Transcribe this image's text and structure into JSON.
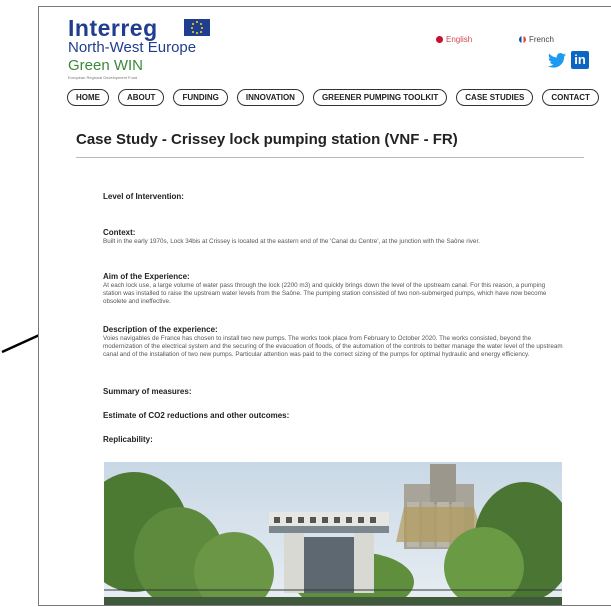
{
  "logo": {
    "interreg": "Interreg",
    "region": "North-West Europe",
    "project": "Green WIN",
    "tagline": "European Regional Development Fund"
  },
  "languages": {
    "english": "English",
    "french": "French"
  },
  "social": {
    "twitter_icon": "twitter-icon",
    "linkedin": "in"
  },
  "nav": [
    "HOME",
    "ABOUT",
    "FUNDING",
    "INNOVATION",
    "GREENER PUMPING TOOLKIT",
    "CASE STUDIES",
    "CONTACT"
  ],
  "page": {
    "title": "Case Study - Crissey lock pumping station  (VNF - FR)"
  },
  "sections": {
    "level": {
      "heading": "Level of Intervention:"
    },
    "context": {
      "heading": "Context:",
      "body": "Built in the early 1970s, Lock 34bis at Crissey is located at the eastern end of the 'Canal du Centre', at the junction with the Saône river."
    },
    "aim": {
      "heading": "Aim of the Experience:",
      "body": "At each lock use, a large volume of water pass through the lock (2200 m3) and quickly brings down the level of the upstream canal. For this reason, a pumping station was installed to raise the upstream water levels from the Saône. The pumping station consisted of two non-submerged pumps, which have now become obsolete and ineffective."
    },
    "description": {
      "heading": "Description of the experience:",
      "body": "Voies navigables de France has chosen to install two new pumps. The works took place from February to October 2020. The works consisted, beyond the modernization of the electrical system and the securing of the evacuation of floods, of the automation of the controls to better manage the water level of the upstream canal and of the installation of two new pumps. Particular attention was paid to the correct sizing of the pumps for optimal hydraulic and energy efficiency."
    },
    "summary": {
      "heading": "Summary of measures:"
    },
    "estimate": {
      "heading": "Estimate of CO2 reductions and other outcomes:"
    },
    "replicability": {
      "heading": "Replicability:"
    }
  },
  "colors": {
    "brand_blue": "#1f3e8f",
    "brand_green": "#3a8a3a",
    "linkedin": "#0a66c2",
    "twitter": "#1d9bf0"
  }
}
